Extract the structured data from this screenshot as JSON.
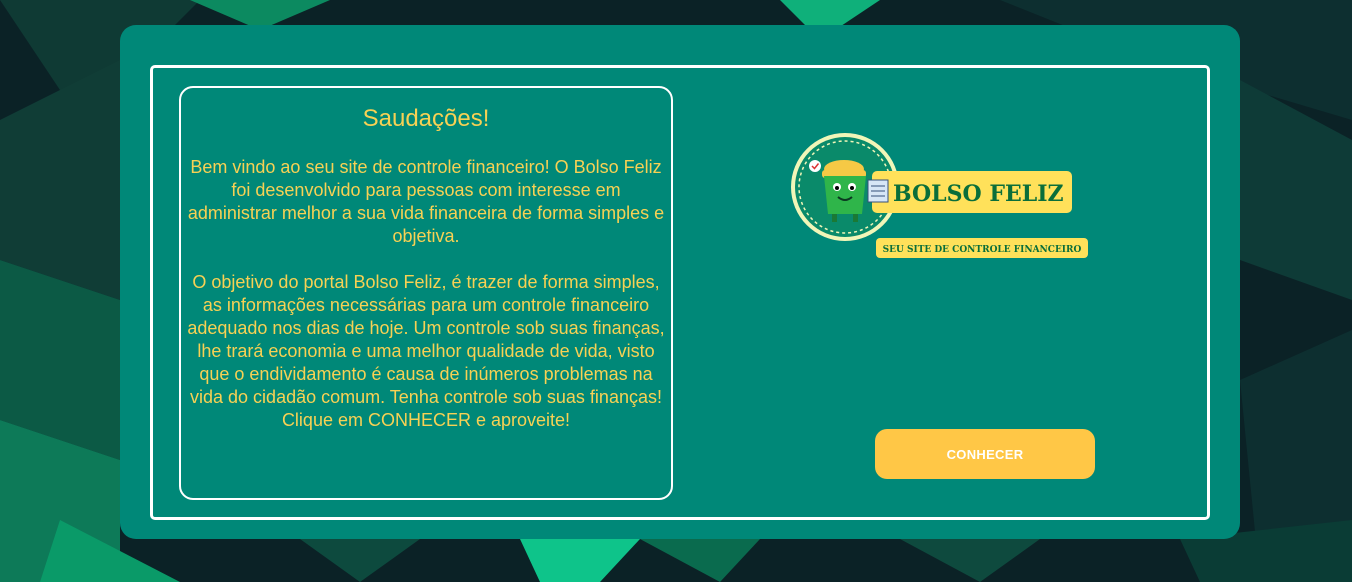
{
  "greeting": {
    "title": "Saudações!",
    "paragraph_1": "Bem vindo ao seu site de controle financeiro! O Bolso Feliz foi desenvolvido para pessoas com interesse em administrar melhor a sua vida financeira de forma simples e objetiva.",
    "paragraph_2": "O objetivo do portal Bolso Feliz, é trazer de forma simples, as informações necessárias para um controle financeiro adequado nos dias de hoje. Um controle sob suas finanças, lhe trará economia e uma melhor qualidade de vida, visto que o endividamento é causa de inúmeros problemas na vida do cidadão comum. Tenha controle sob suas finanças! Clique em CONHECER e aproveite!"
  },
  "logo": {
    "name": "BOLSO FELIZ",
    "tagline": "SEU SITE DE CONTROLE FINANCEIRO"
  },
  "actions": {
    "conhecer_label": "CONHECER"
  },
  "colors": {
    "card": "#008878",
    "text": "#f7d154",
    "button": "#ffc746",
    "logo_dark_green": "#0a6e3a"
  }
}
